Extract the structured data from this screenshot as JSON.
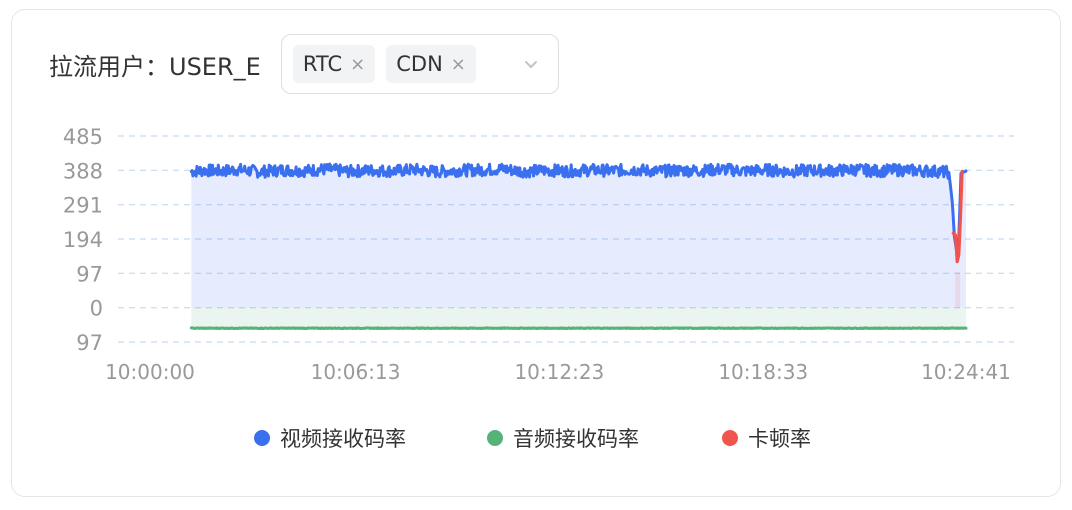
{
  "filter": {
    "user_label": "拉流用户：USER_E",
    "tags": [
      {
        "label": "RTC",
        "close_glyph": "×"
      },
      {
        "label": "CDN",
        "close_glyph": "×"
      }
    ],
    "dropdown_icon": "chevron-down-icon"
  },
  "colors": {
    "video": "#3a6ff0",
    "audio": "#55b378",
    "stall": "#f0544c"
  },
  "chart_data": {
    "type": "line",
    "title": "",
    "xlabel": "",
    "ylabel": "",
    "y_tick_labels": [
      "485",
      "388",
      "291",
      "194",
      "97",
      "0",
      "97"
    ],
    "y_tick_values": [
      485,
      388,
      291,
      194,
      97,
      0,
      -97
    ],
    "ylim": [
      -97,
      485
    ],
    "x_tick_labels": [
      "10:00:00",
      "10:06:13",
      "10:12:23",
      "10:18:33",
      "10:24:41"
    ],
    "x_tick_seconds": [
      0,
      373,
      743,
      1113,
      1481
    ],
    "x_range_seconds": [
      0,
      1481
    ],
    "data_start_seconds": 75,
    "grid": "horizontal-dashed",
    "legend_position": "bottom",
    "series": [
      {
        "name": "视频接收码率",
        "color": "#3a6ff0",
        "area": true,
        "points": [
          [
            75,
            385
          ],
          [
            100,
            388
          ],
          [
            130,
            386
          ],
          [
            160,
            390
          ],
          [
            200,
            384
          ],
          [
            240,
            389
          ],
          [
            280,
            387
          ],
          [
            320,
            391
          ],
          [
            360,
            385
          ],
          [
            400,
            388
          ],
          [
            440,
            386
          ],
          [
            480,
            390
          ],
          [
            520,
            384
          ],
          [
            560,
            388
          ],
          [
            600,
            389
          ],
          [
            640,
            392
          ],
          [
            680,
            385
          ],
          [
            720,
            388
          ],
          [
            760,
            386
          ],
          [
            800,
            389
          ],
          [
            840,
            387
          ],
          [
            880,
            390
          ],
          [
            920,
            385
          ],
          [
            960,
            388
          ],
          [
            1000,
            387
          ],
          [
            1040,
            391
          ],
          [
            1080,
            386
          ],
          [
            1120,
            389
          ],
          [
            1160,
            385
          ],
          [
            1200,
            388
          ],
          [
            1240,
            387
          ],
          [
            1280,
            390
          ],
          [
            1320,
            386
          ],
          [
            1360,
            389
          ],
          [
            1400,
            387
          ],
          [
            1430,
            385
          ],
          [
            1450,
            382
          ],
          [
            1456,
            300
          ],
          [
            1460,
            200
          ],
          [
            1464,
            160
          ],
          [
            1468,
            200
          ],
          [
            1472,
            380
          ],
          [
            1478,
            384
          ],
          [
            1481,
            386
          ]
        ]
      },
      {
        "name": "音频接收码率",
        "color": "#55b378",
        "area": true,
        "points": [
          [
            75,
            -58
          ],
          [
            1481,
            -58
          ]
        ]
      },
      {
        "name": "卡顿率",
        "color": "#f0544c",
        "area": false,
        "points": [
          [
            1458,
            210
          ],
          [
            1462,
            205
          ],
          [
            1465,
            130
          ],
          [
            1468,
            150
          ],
          [
            1471,
            260
          ],
          [
            1474,
            385
          ]
        ]
      }
    ]
  }
}
